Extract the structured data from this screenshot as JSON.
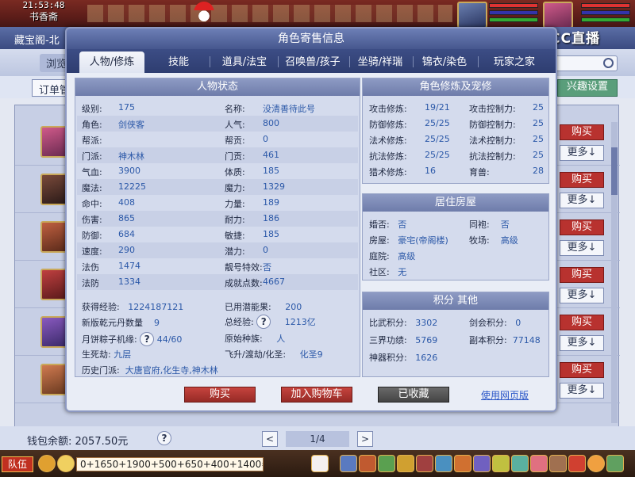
{
  "game": {
    "clock": "21:53:48",
    "location": "书香斋",
    "chat_input": "0+1650+1900+500+650+400+1400=",
    "team_label": "队伍",
    "stream_logo": "CC直播"
  },
  "store": {
    "title": "藏宝阁-北",
    "browse_label": "浏览",
    "order_button": "订单管",
    "interest_button": "兴趣设置",
    "buy_label": "购买",
    "more_label": "更多↓",
    "wallet": "钱包余额: 2057.50元",
    "help_label": "?",
    "page": "1/4",
    "prev": "<",
    "next": ">"
  },
  "dialog": {
    "title": "角色寄售信息",
    "tabs": [
      "人物/修炼",
      "技能",
      "道具/法宝",
      "召唤兽/孩子",
      "坐骑/祥瑞",
      "锦衣/染色",
      "玩家之家"
    ],
    "active_tab": 0,
    "status_panel": {
      "title": "人物状态",
      "left": [
        {
          "k": "级别:",
          "v": "175"
        },
        {
          "k": "角色:",
          "v": "剑侠客"
        },
        {
          "k": "帮派:",
          "v": ""
        },
        {
          "k": "门派:",
          "v": "神木林"
        },
        {
          "k": "气血:",
          "v": "3900"
        },
        {
          "k": "魔法:",
          "v": "12225"
        },
        {
          "k": "命中:",
          "v": "408"
        },
        {
          "k": "伤害:",
          "v": "865"
        },
        {
          "k": "防御:",
          "v": "684"
        },
        {
          "k": "速度:",
          "v": "290"
        },
        {
          "k": "法伤",
          "v": "1474"
        },
        {
          "k": "法防",
          "v": "1334"
        }
      ],
      "right": [
        {
          "k": "名称:",
          "v": "没清善待此号"
        },
        {
          "k": "人气:",
          "v": "800"
        },
        {
          "k": "帮贡:",
          "v": "0"
        },
        {
          "k": "门贡:",
          "v": "461"
        },
        {
          "k": "体质:",
          "v": "185"
        },
        {
          "k": "魔力:",
          "v": "1329"
        },
        {
          "k": "力量:",
          "v": "189"
        },
        {
          "k": "耐力:",
          "v": "186"
        },
        {
          "k": "敏捷:",
          "v": "185"
        },
        {
          "k": "潜力:",
          "v": "0"
        },
        {
          "k": "靓号特效:",
          "v": "否"
        },
        {
          "k": "成就点数:",
          "v": "4667"
        }
      ],
      "exp_label": "获得经验:",
      "exp_value": "1224187121",
      "used_fruit_label": "已用潜能果:",
      "used_fruit_value": "200",
      "qianyuan_label": "新版乾元丹数量",
      "qianyuan_value": "9",
      "total_exp_label": "总经验:",
      "total_exp_value": "1213亿",
      "mooncake_label": "月饼粽子机缘:",
      "mooncake_value": "44/60",
      "race_label": "原始种族:",
      "race_value": "人",
      "sizhi_label": "生死劫:",
      "sizhi_value": "九层",
      "feisheng_label": "飞升/渡劫/化圣:",
      "feisheng_value": "化圣9",
      "history_label": "历史门派:",
      "history_value": "大唐官府,化生寺,神木林"
    },
    "cultivation_panel": {
      "title": "角色修炼及宠修",
      "rows": [
        {
          "k1": "攻击修炼:",
          "v1": "19/21",
          "k2": "攻击控制力:",
          "v2": "25"
        },
        {
          "k1": "防御修炼:",
          "v1": "25/25",
          "k2": "防御控制力:",
          "v2": "25"
        },
        {
          "k1": "法术修炼:",
          "v1": "25/25",
          "k2": "法术控制力:",
          "v2": "25"
        },
        {
          "k1": "抗法修炼:",
          "v1": "25/25",
          "k2": "抗法控制力:",
          "v2": "25"
        },
        {
          "k1": "猎术修炼:",
          "v1": "16",
          "k2": "育兽:",
          "v2": "28"
        }
      ]
    },
    "house_panel": {
      "title": "居住房屋",
      "married_label": "婚否:",
      "married_value": "否",
      "sworn_label": "同袍:",
      "sworn_value": "否",
      "house_label": "房屋:",
      "house_value": "豪宅(帝阁楼)",
      "ranch_label": "牧场:",
      "ranch_value": "高级",
      "yard_label": "庭院:",
      "yard_value": "高级",
      "community_label": "社区:",
      "community_value": "无"
    },
    "points_panel": {
      "title": "积分 其他",
      "pvp_label": "比武积分:",
      "pvp_value": "3302",
      "sword_label": "剑会积分:",
      "sword_value": "0",
      "merit_label": "三界功绩:",
      "merit_value": "5769",
      "dungeon_label": "副本积分:",
      "dungeon_value": "77148",
      "weapon_label": "神器积分:",
      "weapon_value": "1626"
    },
    "buttons": {
      "buy": "购买",
      "add_cart": "加入购物车",
      "favorited": "已收藏",
      "web_version": "使用网页版"
    }
  }
}
